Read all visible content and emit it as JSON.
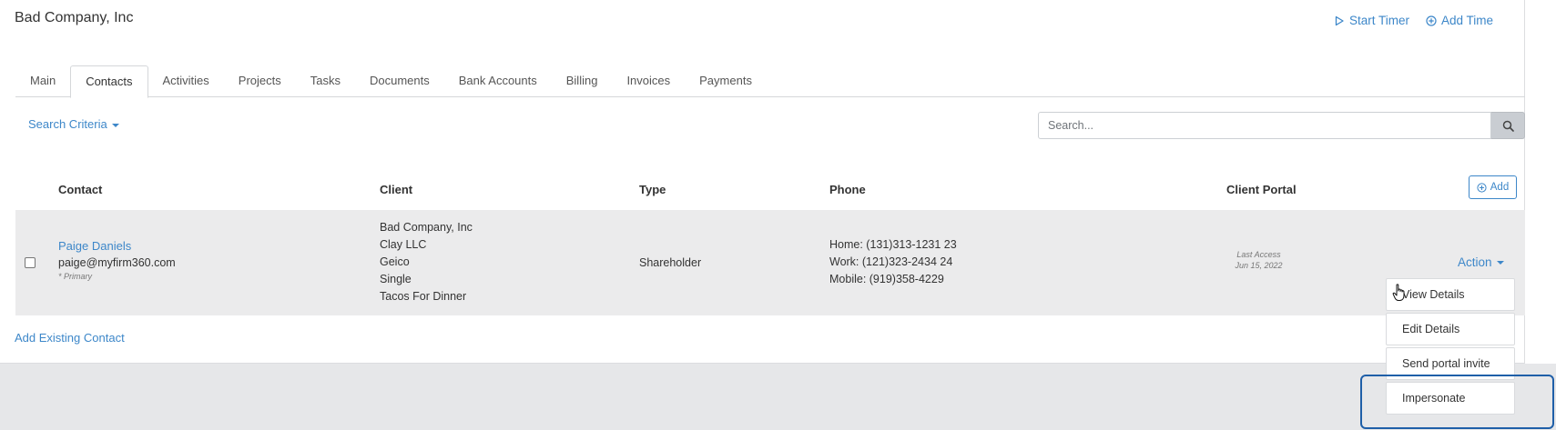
{
  "header": {
    "client_name": "Bad Company, Inc",
    "start_timer": "Start Timer",
    "add_time": "Add Time"
  },
  "tabs": [
    {
      "label": "Main",
      "active": false
    },
    {
      "label": "Contacts",
      "active": true
    },
    {
      "label": "Activities",
      "active": false
    },
    {
      "label": "Projects",
      "active": false
    },
    {
      "label": "Tasks",
      "active": false
    },
    {
      "label": "Documents",
      "active": false
    },
    {
      "label": "Bank Accounts",
      "active": false
    },
    {
      "label": "Billing",
      "active": false
    },
    {
      "label": "Invoices",
      "active": false
    },
    {
      "label": "Payments",
      "active": false
    }
  ],
  "filters": {
    "search_criteria": "Search Criteria",
    "search_placeholder": "Search..."
  },
  "table": {
    "columns": {
      "contact": "Contact",
      "client": "Client",
      "type": "Type",
      "phone": "Phone",
      "client_portal": "Client Portal"
    },
    "add_label": "Add",
    "rows": [
      {
        "name": "Paige Daniels",
        "email": "paige@myfirm360.com",
        "primary": "* Primary",
        "clients": [
          "Bad Company, Inc",
          "Clay LLC",
          "Geico",
          "Single",
          "Tacos For Dinner"
        ],
        "type": "Shareholder",
        "phones": [
          "Home: (131)313-1231 23",
          "Work: (121)323-2434 24",
          "Mobile: (919)358-4229"
        ],
        "last_access_label": "Last Access",
        "last_access_date": "Jun 15, 2022",
        "action_label": "Action"
      }
    ]
  },
  "add_existing_contact": "Add Existing Contact",
  "action_menu": {
    "items": [
      "View Details",
      "Edit Details",
      "Send portal invite",
      "Impersonate"
    ]
  },
  "colors": {
    "link": "#3d87c9",
    "highlight": "#1f5fa8",
    "row_background": "#ebebec"
  }
}
